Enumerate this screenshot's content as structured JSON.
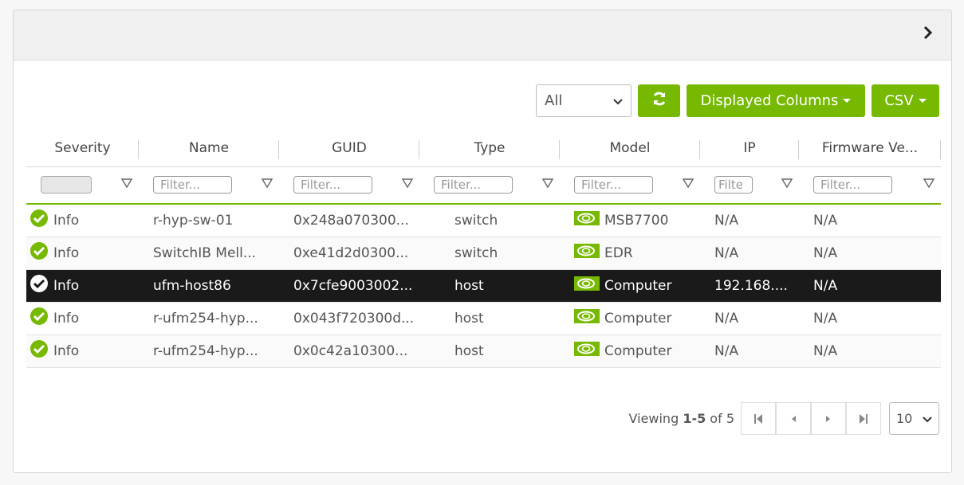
{
  "toolbar": {
    "filter_select": "All",
    "displayed_columns_label": "Displayed Columns",
    "csv_label": "CSV"
  },
  "columns": [
    "Severity",
    "Name",
    "GUID",
    "Type",
    "Model",
    "IP",
    "Firmware Ve..."
  ],
  "filters": {
    "placeholder": "Filter...",
    "ip_placeholder": "Filte"
  },
  "rows": [
    {
      "severity": "Info",
      "name": "r-hyp-sw-01",
      "guid": "0x248a070300...",
      "type": "switch",
      "model": "MSB7700",
      "ip": "N/A",
      "firmware": "N/A"
    },
    {
      "severity": "Info",
      "name": "SwitchIB Mell...",
      "guid": "0xe41d2d0300...",
      "type": "switch",
      "model": "EDR",
      "ip": "N/A",
      "firmware": "N/A"
    },
    {
      "severity": "Info",
      "name": "ufm-host86",
      "guid": "0x7cfe9003002...",
      "type": "host",
      "model": "Computer",
      "ip": "192.168....",
      "firmware": "N/A"
    },
    {
      "severity": "Info",
      "name": "r-ufm254-hyp...",
      "guid": "0x043f720300d...",
      "type": "host",
      "model": "Computer",
      "ip": "N/A",
      "firmware": "N/A"
    },
    {
      "severity": "Info",
      "name": "r-ufm254-hyp...",
      "guid": "0x0c42a10300...",
      "type": "host",
      "model": "Computer",
      "ip": "N/A",
      "firmware": "N/A"
    }
  ],
  "pagination": {
    "viewing_prefix": "Viewing ",
    "range": "1-5",
    "of_text": " of 5",
    "page_size": "10"
  },
  "colors": {
    "accent": "#76b900",
    "selected_row": "#1a1a1a"
  },
  "icons": [
    "chevron-right-icon",
    "refresh-icon",
    "funnel-icon",
    "check-circle-icon",
    "nvidia-logo-icon",
    "first-page-icon",
    "prev-page-icon",
    "next-page-icon",
    "last-page-icon",
    "chevron-down-icon"
  ]
}
